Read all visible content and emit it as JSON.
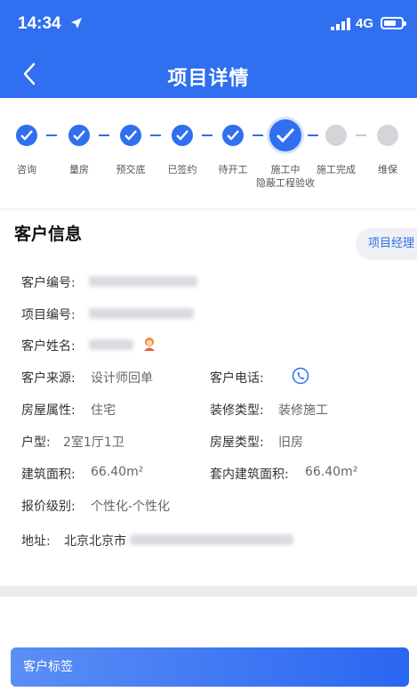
{
  "status_bar": {
    "time": "14:34",
    "network": "4G"
  },
  "header": {
    "title": "项目详情"
  },
  "steps": [
    {
      "label": "咨询",
      "done": true
    },
    {
      "label": "量房",
      "done": true
    },
    {
      "label": "预交底",
      "done": true
    },
    {
      "label": "已签约",
      "done": true
    },
    {
      "label": "待开工",
      "done": true
    },
    {
      "label": "施工中",
      "label2": "隐蔽工程验收",
      "current": true
    },
    {
      "label": "施工完成",
      "done": false
    },
    {
      "label": "维保",
      "done": false
    }
  ],
  "customer_info": {
    "title": "客户信息",
    "pm_tag": "项目经理",
    "fields": {
      "customer_no_label": "客户编号:",
      "project_no_label": "项目编号:",
      "customer_name_label": "客户姓名:",
      "source_label": "客户来源:",
      "source_value": "设计师回单",
      "phone_label": "客户电话:",
      "property_label": "房屋属性:",
      "property_value": "住宅",
      "decoration_label": "装修类型:",
      "decoration_value": "装修施工",
      "layout_label": "户型:",
      "layout_value": "2室1厅1卫",
      "house_type_label": "房屋类型:",
      "house_type_value": "旧房",
      "area_label": "建筑面积:",
      "area_value": "66.40m²",
      "inner_area_label": "套内建筑面积:",
      "inner_area_value": "66.40m²",
      "quote_label": "报价级别:",
      "quote_value": "个性化-个性化",
      "address_label": "地址:",
      "address_value": "北京北京市"
    }
  },
  "bottom": {
    "tag_label": "客户标签"
  },
  "colors": {
    "primary": "#2f6ff0",
    "pending": "#d4d5d8"
  }
}
